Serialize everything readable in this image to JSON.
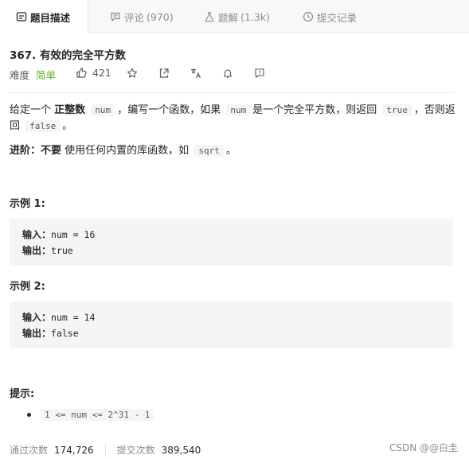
{
  "tabs": [
    {
      "label": "题目描述",
      "count": "",
      "icon": "document-icon",
      "active": true
    },
    {
      "label": "评论",
      "count": "(970)",
      "icon": "comment-icon",
      "active": false
    },
    {
      "label": "题解",
      "count": "(1.3k)",
      "icon": "flask-icon",
      "active": false
    },
    {
      "label": "提交记录",
      "count": "",
      "icon": "clock-icon",
      "active": false
    }
  ],
  "problem": {
    "title": "367. 有效的完全平方数",
    "difficulty_label": "难度",
    "difficulty_value": "简单",
    "likes": "421"
  },
  "description": {
    "p1_a": "给定一个",
    "p1_bold": "正整数",
    "p1_code1": "num",
    "p1_b": "，编写一个函数，如果",
    "p1_code2": "num",
    "p1_c": "是一个完全平方数，则返回",
    "p1_code3": "true",
    "p1_d": "，否则返",
    "p1_e": "回",
    "p1_code4": "false",
    "p1_f": "。",
    "p2_bold": "进阶：",
    "p2_bold2": "不要",
    "p2_a": "使用任何内置的库函数，如",
    "p2_code": "sqrt",
    "p2_b": "。"
  },
  "examples": [
    {
      "heading": "示例 1:",
      "input_label": "输入：",
      "input": "num = 16",
      "output_label": "输出：",
      "output": "true"
    },
    {
      "heading": "示例 2:",
      "input_label": "输入：",
      "input": "num = 14",
      "output_label": "输出：",
      "output": "false"
    }
  ],
  "hints": {
    "heading": "提示:",
    "items": [
      "1 <= num <= 2^31 - 1"
    ]
  },
  "stats": {
    "accepted_label": "通过次数",
    "accepted": "174,726",
    "submitted_label": "提交次数",
    "submitted": "389,540"
  },
  "watermark": "CSDN @@白圭",
  "colors": {
    "easy": "#5ab726",
    "tab_bg": "#f7f8fa",
    "code_bg": "#f5f5f5"
  }
}
